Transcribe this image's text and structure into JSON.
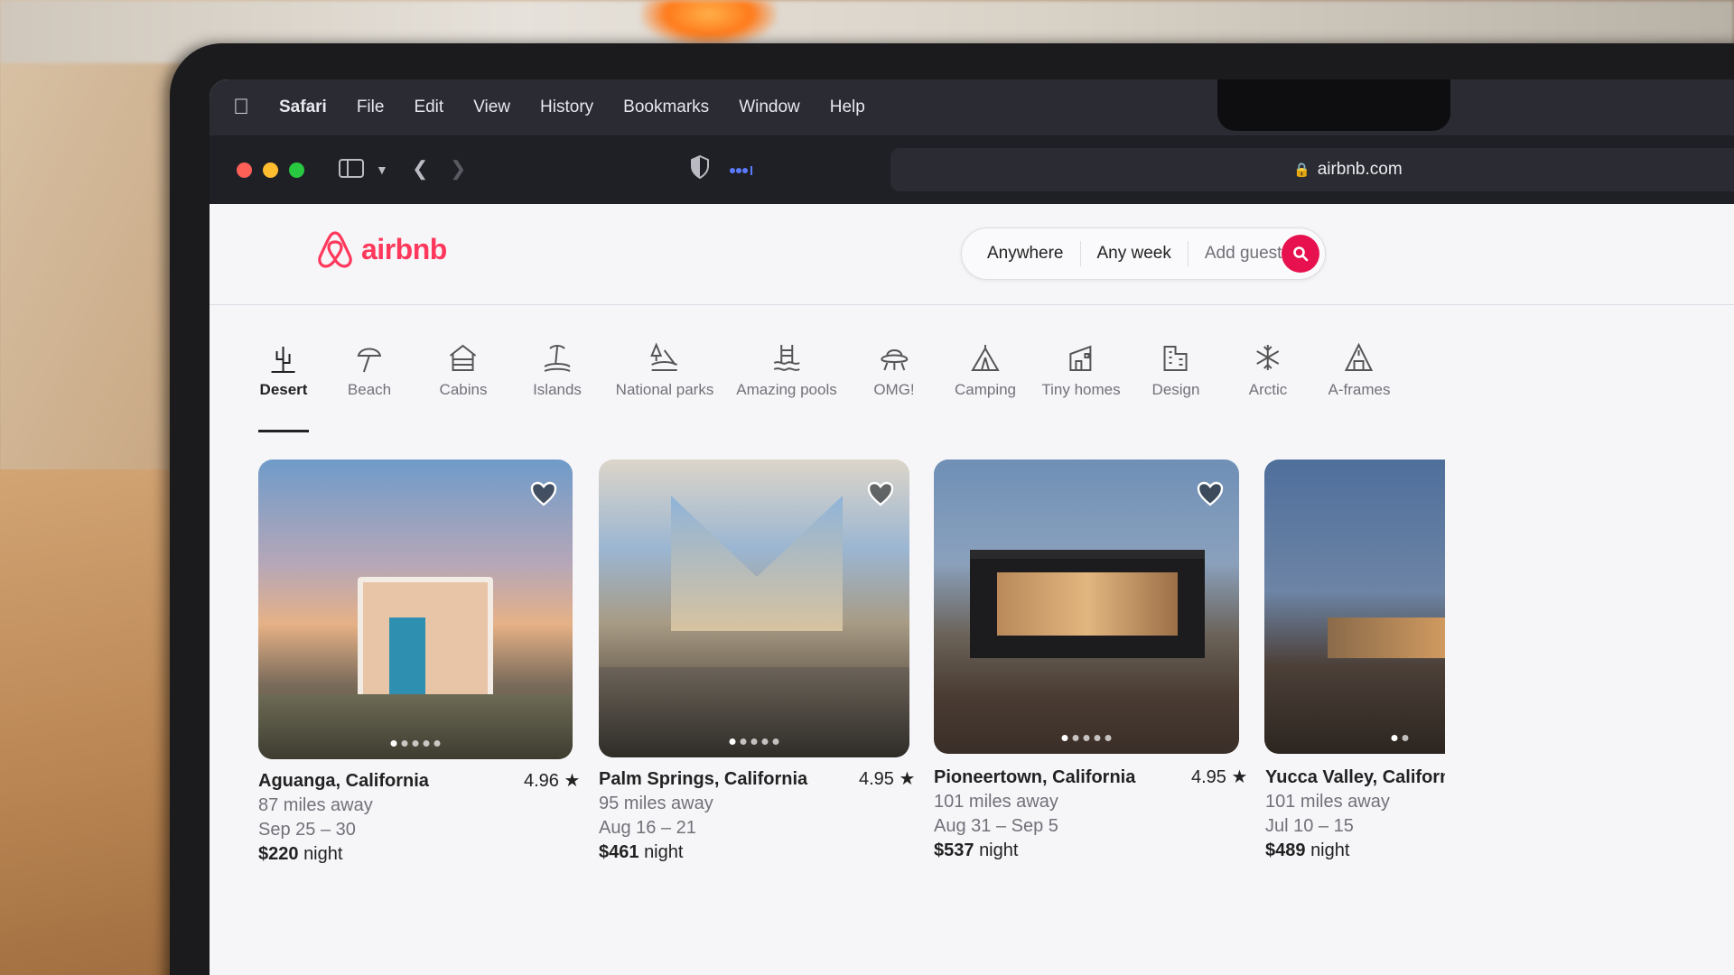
{
  "menubar": {
    "app": "Safari",
    "items": [
      "File",
      "Edit",
      "View",
      "History",
      "Bookmarks",
      "Window",
      "Help"
    ]
  },
  "browser": {
    "url": "airbnb.com"
  },
  "brand": {
    "name": "airbnb",
    "accent": "#ff385c"
  },
  "search": {
    "where": "Anywhere",
    "when": "Any week",
    "who": "Add guests"
  },
  "categories": [
    {
      "label": "Desert",
      "icon": "cactus-icon",
      "active": true
    },
    {
      "label": "Beach",
      "icon": "umbrella-icon"
    },
    {
      "label": "Cabins",
      "icon": "cabin-icon"
    },
    {
      "label": "Islands",
      "icon": "island-icon"
    },
    {
      "label": "National parks",
      "icon": "park-icon"
    },
    {
      "label": "Amazing pools",
      "icon": "pool-icon"
    },
    {
      "label": "OMG!",
      "icon": "ufo-icon"
    },
    {
      "label": "Camping",
      "icon": "tent-icon"
    },
    {
      "label": "Tiny homes",
      "icon": "tiny-home-icon"
    },
    {
      "label": "Design",
      "icon": "design-icon"
    },
    {
      "label": "Arctic",
      "icon": "snowflake-icon"
    },
    {
      "label": "A-frames",
      "icon": "a-frame-icon"
    }
  ],
  "listings": [
    {
      "location": "Aguanga, California",
      "rating": "4.96",
      "distance": "87 miles away",
      "dates": "Sep 25 – 30",
      "price": "$220",
      "unit": "night"
    },
    {
      "location": "Palm Springs, California",
      "rating": "4.95",
      "distance": "95 miles away",
      "dates": "Aug 16 – 21",
      "price": "$461",
      "unit": "night"
    },
    {
      "location": "Pioneertown, California",
      "rating": "4.95",
      "distance": "101 miles away",
      "dates": "Aug 31 – Sep 5",
      "price": "$537",
      "unit": "night"
    },
    {
      "location": "Yucca Valley, Californ",
      "rating": "",
      "distance": "101 miles away",
      "dates": "Jul 10 – 15",
      "price": "$489",
      "unit": "night"
    }
  ]
}
